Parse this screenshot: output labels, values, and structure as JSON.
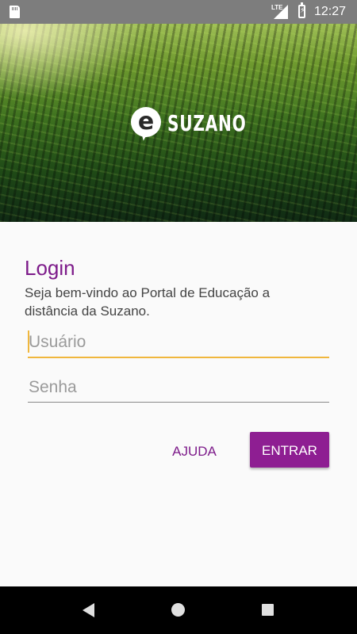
{
  "status_bar": {
    "network_label": "LTE",
    "time": "12:27",
    "icons": [
      "sd-card-icon",
      "signal-icon",
      "battery-charging-icon"
    ]
  },
  "hero": {
    "logo_letter": "e",
    "logo_text": "SUZANO"
  },
  "login": {
    "title": "Login",
    "welcome": "Seja bem-vindo ao Portal de Educação a distância da Suzano.",
    "username_placeholder": "Usuário",
    "username_value": "",
    "password_placeholder": "Senha",
    "password_value": "",
    "help_label": "AJUDA",
    "enter_label": "ENTRAR"
  },
  "colors": {
    "accent_purple": "#8e1e92",
    "title_purple": "#7d1b8a",
    "focus_yellow": "#f0b73d",
    "status_bar": "#7d7d7d"
  },
  "nav_bar": {
    "icons": [
      "back-icon",
      "home-icon",
      "recents-icon"
    ]
  }
}
